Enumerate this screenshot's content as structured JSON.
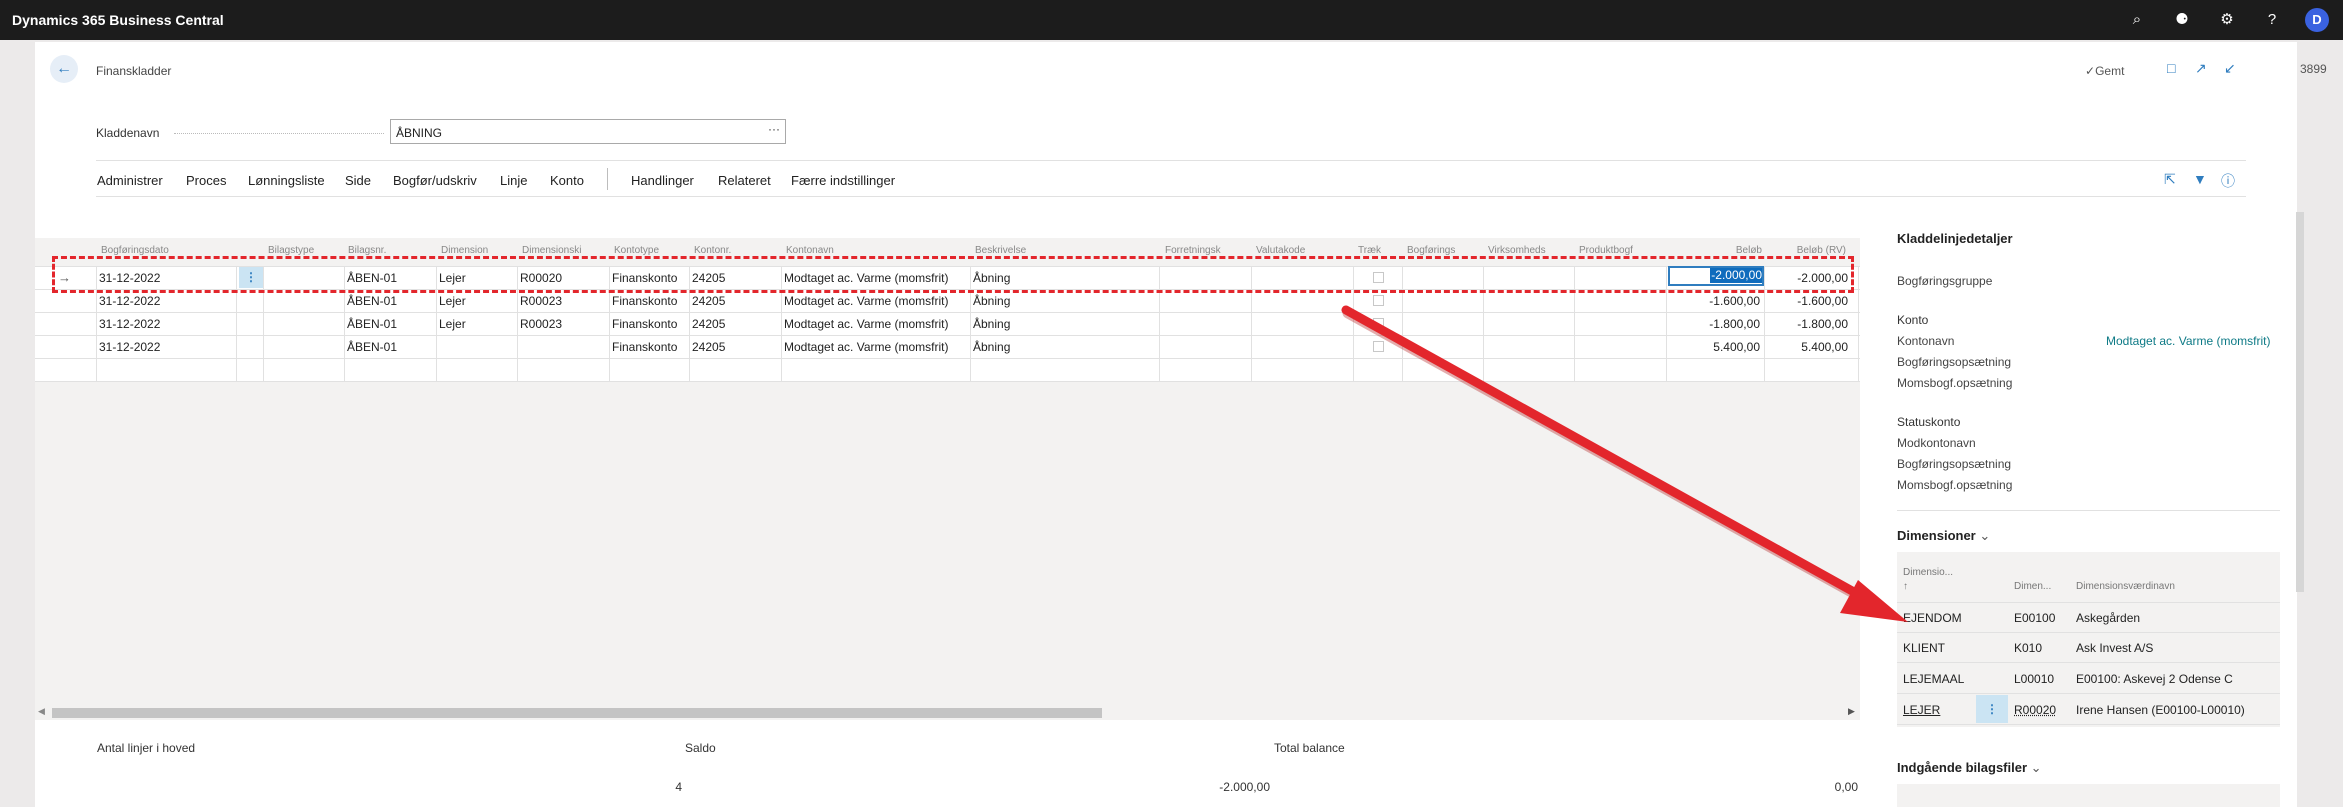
{
  "app": {
    "title": "Dynamics 365 Business Central",
    "avatar_initial": "D"
  },
  "side_number": "3899",
  "header": {
    "page_title": "Finanskladder",
    "saved_label": "Gemt"
  },
  "journal": {
    "name_label": "Kladdenavn",
    "name_value": "ÅBNING",
    "name_ellipsis": "···"
  },
  "menu": {
    "items": [
      "Administrer",
      "Proces",
      "Lønningsliste",
      "Side",
      "Bogfør/udskriv",
      "Linje",
      "Konto",
      "Handlinger",
      "Relateret",
      "Færre indstillinger"
    ]
  },
  "grid": {
    "columns": [
      "Bogføringsdato",
      "Bilagstype",
      "Bilagsnr.",
      "Dimension",
      "Dimensionski",
      "Kontotype",
      "Kontonr.",
      "Kontonavn",
      "Beskrivelse",
      "Forretningsk",
      "Valutakode",
      "Træk",
      "Bogførings",
      "Virksomheds",
      "Produktbogf",
      "Beløb",
      "Beløb (RV)"
    ],
    "rows": [
      {
        "date": "31-12-2022",
        "doc_no": "ÅBEN-01",
        "dimension": "Lejer",
        "dim_key": "R00020",
        "account_type": "Finanskonto",
        "account_no": "24205",
        "account_name": "Modtaget ac. Varme (momsfrit)",
        "description": "Åbning",
        "amount": "-2.000,00",
        "amount_lcy": "-2.000,00"
      },
      {
        "date": "31-12-2022",
        "doc_no": "ÅBEN-01",
        "dimension": "Lejer",
        "dim_key": "R00023",
        "account_type": "Finanskonto",
        "account_no": "24205",
        "account_name": "Modtaget ac. Varme (momsfrit)",
        "description": "Åbning",
        "amount": "-1.600,00",
        "amount_lcy": "-1.600,00"
      },
      {
        "date": "31-12-2022",
        "doc_no": "ÅBEN-01",
        "dimension": "Lejer",
        "dim_key": "R00023",
        "account_type": "Finanskonto",
        "account_no": "24205",
        "account_name": "Modtaget ac. Varme (momsfrit)",
        "description": "Åbning",
        "amount": "-1.800,00",
        "amount_lcy": "-1.800,00"
      },
      {
        "date": "31-12-2022",
        "doc_no": "ÅBEN-01",
        "dimension": "",
        "dim_key": "",
        "account_type": "Finanskonto",
        "account_no": "24205",
        "account_name": "Modtaget ac. Varme (momsfrit)",
        "description": "Åbning",
        "amount": "5.400,00",
        "amount_lcy": "5.400,00"
      }
    ]
  },
  "totals": {
    "lines_label": "Antal linjer i hoved",
    "lines_value": "4",
    "balance_label": "Saldo",
    "balance_value": "-2.000,00",
    "total_label": "Total balance",
    "total_value": "0,00"
  },
  "factbox": {
    "title": "Kladdelinjedetaljer",
    "posting_group": "Bogføringsgruppe",
    "account_section": "Konto",
    "account_name_label": "Kontonavn",
    "account_name_value": "Modtaget ac. Varme (momsfrit)",
    "posting_setup": "Bogføringsopsætning",
    "vat_setup": "Momsbogf.opsætning",
    "balance_section": "Statuskonto",
    "bal_account_name": "Modkontonavn",
    "bal_posting_setup": "Bogføringsopsætning",
    "bal_vat_setup": "Momsbogf.opsætning",
    "dimensions_title": "Dimensioner",
    "dim_headers": [
      "Dimensio...",
      "Dimen...",
      "Dimensionsværdinavn"
    ],
    "dim_sort_arrow": "↑",
    "dim_rows": [
      {
        "code": "EJENDOM",
        "value": "E00100",
        "name": "Askegården"
      },
      {
        "code": "KLIENT",
        "value": "K010",
        "name": "Ask Invest A/S"
      },
      {
        "code": "LEJEMAAL",
        "value": "L00010",
        "name": "E00100: Askevej 2 Odense C"
      },
      {
        "code": "LEJER",
        "value": "R00020",
        "name": "Irene Hansen (E00100-L00010)"
      }
    ],
    "incoming_title": "Indgående bilagsfiler"
  },
  "colors": {
    "accent": "#2f7dbf",
    "selection": "#0f6cbd",
    "annotation_red": "#e3262c",
    "link_teal": "#0e7a86"
  }
}
